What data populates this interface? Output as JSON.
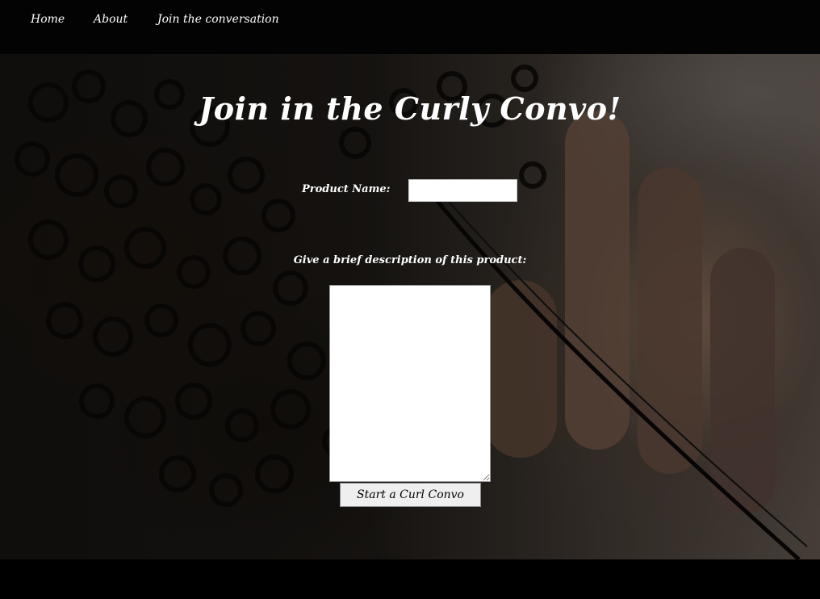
{
  "nav": {
    "items": [
      {
        "label": "Home"
      },
      {
        "label": "About"
      },
      {
        "label": "Join the conversation"
      }
    ]
  },
  "main": {
    "title": "Join in the Curly Convo!",
    "form": {
      "product_name_label": "Product Name:",
      "product_name_value": "",
      "description_label": "Give a brief description of this product:",
      "description_value": "",
      "submit_label": "Start a Curl Convo"
    }
  },
  "colors": {
    "nav_background": "#030303",
    "text": "#ffffff",
    "button_background": "#efefef"
  }
}
